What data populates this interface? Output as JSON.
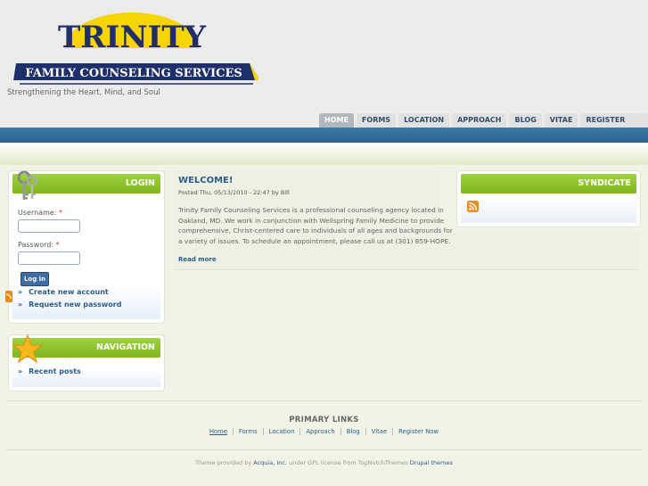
{
  "site": {
    "name_top": "TRINITY",
    "name_bottom": "FAMILY COUNSELING SERVICES",
    "slogan": "Strengthening the Heart, Mind, and Soul"
  },
  "nav": [
    {
      "label": "HOME",
      "active": true
    },
    {
      "label": "FORMS"
    },
    {
      "label": "LOCATION"
    },
    {
      "label": "APPROACH"
    },
    {
      "label": "BLOG"
    },
    {
      "label": "VITAE"
    },
    {
      "label": "REGISTER NOW"
    }
  ],
  "login": {
    "title": "LOGIN",
    "username_label": "Username:",
    "password_label": "Password:",
    "required_mark": "*",
    "button": "Log in",
    "links": [
      "Create new account",
      "Request new password"
    ]
  },
  "navigation": {
    "title": "NAVIGATION",
    "links": [
      "Recent posts"
    ]
  },
  "syndicate": {
    "title": "SYNDICATE"
  },
  "post": {
    "title": "WELCOME!",
    "meta": "Posted Thu, 05/13/2010 - 22:47 by Bill",
    "body": "Trinity Family Counseling Services is a professional counseling agency located in Oakland, MD. We work in conjunction with Wellspring Family Medicine to provide comprehensive, Christ-centered care to individuals of all ages and backgrounds for a variety of issues. To schedule an appointment, please call us at (301) 859-HOPE.",
    "read_more": "Read more"
  },
  "footer": {
    "primary_links_title": "PRIMARY LINKS",
    "links": [
      "Home",
      "Forms",
      "Location",
      "Approach",
      "Blog",
      "Vitae",
      "Register Now"
    ],
    "credits_1": "Theme provided by",
    "credits_acquia": "Acquia, Inc.",
    "credits_2": "under GPL license from TopNotchThemes",
    "credits_drupal": "Drupal themes"
  },
  "colors": {
    "accent_green": "#8dc42f",
    "nav_blue": "#3d7aa5",
    "link_blue": "#2b5d8a",
    "logo_navy": "#1f2f6b",
    "logo_yellow": "#f7d500"
  }
}
